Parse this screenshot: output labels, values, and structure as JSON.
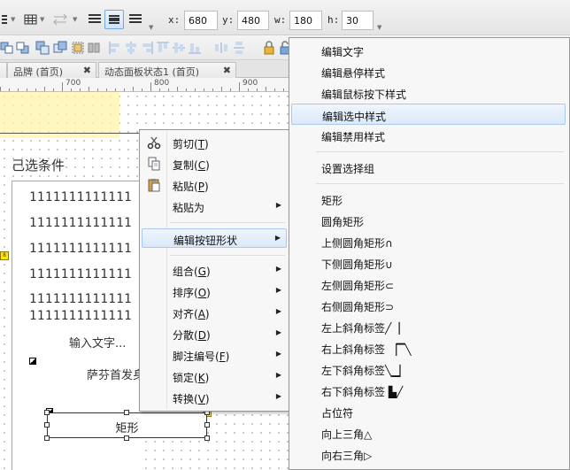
{
  "toolbar": {
    "x_label": "x:",
    "x_value": "680",
    "y_label": "y:",
    "y_value": "480",
    "w_label": "w:",
    "w_value": "180",
    "h_label": "h:",
    "h_value": "30"
  },
  "tabs": [
    {
      "label": "品牌 (首页)",
      "close": "✖"
    },
    {
      "label": "动态面板状态1 (首页)",
      "close": "✖"
    }
  ],
  "ruler": {
    "marks": [
      "700",
      "800",
      "900"
    ]
  },
  "canvas": {
    "condition_label": "己选条件",
    "number_rows": [
      "1111111111111",
      "1111111111111",
      "1111111111111",
      "1111111111111",
      "1111111111111",
      "1111111111111"
    ],
    "input_text": "输入文字...",
    "sofa_text": "萨芬首发身",
    "rect_label": "矩形"
  },
  "context_menu": {
    "items": [
      {
        "label": "剪切",
        "key": "T",
        "icon": "scissors-icon"
      },
      {
        "label": "复制",
        "key": "C",
        "icon": "copy-icon"
      },
      {
        "label": "粘贴",
        "key": "P",
        "icon": "paste-icon"
      },
      {
        "label": "粘贴为"
      },
      {
        "label": "编辑按钮形状"
      },
      {
        "label": "组合",
        "key": "G"
      },
      {
        "label": "排序",
        "key": "O"
      },
      {
        "label": "对齐",
        "key": "A"
      },
      {
        "label": "分散",
        "key": "D"
      },
      {
        "label": "脚注编号",
        "key": "F"
      },
      {
        "label": "锁定",
        "key": "K"
      },
      {
        "label": "转换",
        "key": "V"
      }
    ]
  },
  "submenu": {
    "items": [
      "编辑文字",
      "编辑悬停样式",
      "编辑鼠标按下样式",
      "编辑选中样式",
      "编辑禁用样式",
      "设置选择组",
      "矩形",
      "圆角矩形",
      "上侧圆角矩形∩",
      "下侧圆角矩形∪",
      "左侧圆角矩形⊂",
      "右侧圆角矩形⊃",
      "左上斜角标签╱▕",
      "右上斜角标签 ▕▔╲",
      "左下斜角标签╲▁▏",
      "右下斜角标签 ▙╱",
      "占位符",
      "向上三角△",
      "向右三角▷"
    ]
  }
}
